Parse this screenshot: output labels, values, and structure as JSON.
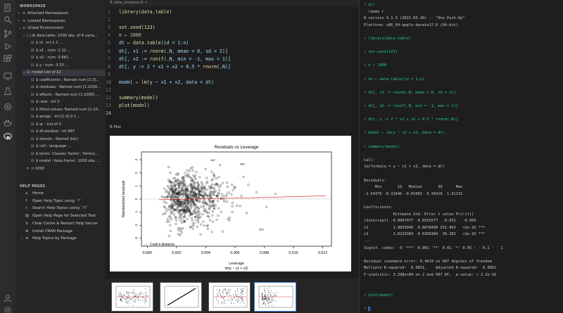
{
  "activity": {
    "icons": [
      "files-icon",
      "search-icon",
      "source-control-icon",
      "run-debug-icon",
      "extensions-icon",
      "remote-icon",
      "test-icon",
      "git-icon",
      "docker-icon",
      "r-icon",
      "account-icon",
      "settings-icon"
    ]
  },
  "workspace": {
    "title": "WORKSPACE",
    "rows": [
      {
        "text": "Attached Namespaces",
        "chev": "›",
        "icon": "≡",
        "indent": 0
      },
      {
        "text": "Loaded Namespaces",
        "chev": "›",
        "icon": "≡",
        "indent": 0
      },
      {
        "text": "Global Environment",
        "chev": "⌄",
        "icon": "≡",
        "indent": 0
      },
      {
        "text": "dt  data.table: 1000 obs. of 4 varia...",
        "chev": "⌄",
        "icon": "[ ]",
        "indent": 1
      },
      {
        "text": "$ id : int 1 2 ...",
        "chev": "",
        "icon": "⊟",
        "indent": 2
      },
      {
        "text": "$ x1 : num -1.12 ...",
        "chev": "",
        "icon": "⊟",
        "indent": 2
      },
      {
        "text": "$ x2 : num -0.681 ...",
        "chev": "",
        "icon": "⊟",
        "indent": 2
      },
      {
        "text": "$ y : num -3.33 ...",
        "chev": "",
        "icon": "⊟",
        "indent": 2
      },
      {
        "text": "model  List of 12",
        "chev": "⌄",
        "icon": "⊟",
        "indent": 1
      },
      {
        "text": "$ coefficients : Named num [1:3]...",
        "chev": "",
        "icon": "⊟",
        "indent": 2
      },
      {
        "text": "$ residuals : Named num [1:1000...",
        "chev": "",
        "icon": "⊟",
        "indent": 2
      },
      {
        "text": "$ effects : Named num [1:1000] ...",
        "chev": "",
        "icon": "⊟",
        "indent": 2
      },
      {
        "text": "$ rank : int 3",
        "chev": "",
        "icon": "⊟",
        "indent": 2
      },
      {
        "text": "$ fitted.values: Named num [1:10...",
        "chev": "",
        "icon": "⊟",
        "indent": 2
      },
      {
        "text": "$ assign : int [1:3] 0 1 ...",
        "chev": "",
        "icon": "⊟",
        "indent": 2
      },
      {
        "text": "$ qr : List of 5",
        "chev": "",
        "icon": "⊟",
        "indent": 2
      },
      {
        "text": "$ df.residual : int 997",
        "chev": "",
        "icon": "⊟",
        "indent": 2
      },
      {
        "text": "$ xlevels : Named list()",
        "chev": "",
        "icon": "⊟",
        "indent": 2
      },
      {
        "text": "$ call : language ...",
        "chev": "",
        "icon": "⊟",
        "indent": 2
      },
      {
        "text": "$ terms :Classes 'terms', 'formul...",
        "chev": "",
        "icon": "⊟",
        "indent": 2
      },
      {
        "text": "$ model :'data.frame': 1000 obs. ...",
        "chev": "",
        "icon": "⊟",
        "indent": 2
      },
      {
        "text": "n  1000",
        "chev": "",
        "icon": "π",
        "indent": 1
      }
    ]
  },
  "help": {
    "title": "HELP PAGES",
    "items": [
      {
        "label": "Home",
        "icon": "⌂",
        "chev": ""
      },
      {
        "label": "Open Help Topic using `?`",
        "icon": "?",
        "chev": ""
      },
      {
        "label": "Search Help Topics using `??`",
        "icon": "⌕",
        "chev": ""
      },
      {
        "label": "Open Help Page for Selected Text",
        "icon": "▤",
        "chev": ""
      },
      {
        "label": "Clear Cache & Restart Help Server",
        "icon": "↻",
        "chev": ""
      },
      {
        "label": "Install CRAN Package",
        "icon": "⊕",
        "chev": ""
      },
      {
        "label": "Help Topics by Package",
        "icon": "≡",
        "chev": "›"
      }
    ]
  },
  "editor": {
    "tab": "R  data_analysis.R > ...",
    "lines": [
      {
        "n": "1",
        "code": [
          {
            "t": "library(data.table)",
            "c": "#dcdcaa"
          }
        ]
      },
      {
        "n": "2",
        "code": []
      },
      {
        "n": "3",
        "code": [
          {
            "t": "set.seed(123)",
            "c": "#dcdcaa"
          }
        ]
      },
      {
        "n": "4",
        "code": [
          {
            "t": "n ",
            "c": "#9cdcfe"
          },
          {
            "t": "←",
            "c": "#d4d4d4"
          },
          {
            "t": " 1000",
            "c": "#b5cea8"
          }
        ]
      },
      {
        "n": "5",
        "code": [
          {
            "t": "dt ",
            "c": "#9cdcfe"
          },
          {
            "t": "← ",
            "c": "#d4d4d4"
          },
          {
            "t": "data.table(",
            "c": "#dcdcaa"
          },
          {
            "t": "id = 1:n)",
            "c": "#9cdcfe"
          }
        ]
      },
      {
        "n": "6",
        "code": [
          {
            "t": "dt[, x1 := ",
            "c": "#9cdcfe"
          },
          {
            "t": "rnorm(",
            "c": "#dcdcaa"
          },
          {
            "t": ".N, mean = 0, sd = 2)]",
            "c": "#9cdcfe"
          }
        ]
      },
      {
        "n": "7",
        "code": [
          {
            "t": "dt[, x2 := ",
            "c": "#9cdcfe"
          },
          {
            "t": "runif(",
            "c": "#dcdcaa"
          },
          {
            "t": ".N, min = -1, max = 1)]",
            "c": "#9cdcfe"
          }
        ]
      },
      {
        "n": "8",
        "code": [
          {
            "t": "dt[, y := 2 * x1 + x2 + 0.5 * ",
            "c": "#9cdcfe"
          },
          {
            "t": "rnorm(",
            "c": "#dcdcaa"
          },
          {
            "t": ".N)]",
            "c": "#9cdcfe"
          }
        ]
      },
      {
        "n": "9",
        "code": []
      },
      {
        "n": "10",
        "code": [
          {
            "t": "model ",
            "c": "#9cdcfe"
          },
          {
            "t": "← ",
            "c": "#d4d4d4"
          },
          {
            "t": "lm(",
            "c": "#dcdcaa"
          },
          {
            "t": "y ~ x1 + x2, data = dt)",
            "c": "#9cdcfe"
          }
        ]
      },
      {
        "n": "11",
        "code": []
      },
      {
        "n": "12",
        "code": [
          {
            "t": "summary(model)",
            "c": "#dcdcaa"
          }
        ]
      },
      {
        "n": "13",
        "code": [
          {
            "t": "plot(model)",
            "c": "#dcdcaa"
          }
        ]
      },
      {
        "n": "14",
        "code": []
      }
    ]
  },
  "plot": {
    "tab": "R Plot",
    "title": "Residuals vs Leverage",
    "xlabel": "Leverage",
    "xlabel2": "lm(y ~ x1 + x2)",
    "ylabel": "Standardized residuals",
    "legend": "Cook's distance",
    "xticks": [
      "0.000",
      "0.002",
      "0.004",
      "0.006",
      "0.008",
      "0.010",
      "0.012"
    ],
    "yticks": [
      "-3",
      "-2",
      "-1",
      "0",
      "1",
      "2",
      "3"
    ],
    "labels": [
      "667",
      "286",
      "526"
    ]
  },
  "terminal": {
    "lines": [
      {
        "p": "> ",
        "c": "q()",
        "style": "cmd"
      },
      {
        "p": "",
        "c": "  rdome r",
        "style": "plain"
      },
      {
        "p": "",
        "c": "R version 4.1.3 (2022-03-10) -- \"One Push-Up\"",
        "style": "plain"
      },
      {
        "p": "",
        "c": "Platform: x86_64-apple-darwin17.0 (64-bit)",
        "style": "plain"
      },
      {
        "p": "",
        "c": "",
        "style": "plain"
      },
      {
        "p": "> ",
        "c": "library(data.table)",
        "style": "cmd"
      },
      {
        "p": "",
        "c": "",
        "style": "plain"
      },
      {
        "p": "> ",
        "c": "set.seed(123)",
        "style": "cmd"
      },
      {
        "p": "",
        "c": "",
        "style": "plain"
      },
      {
        "p": "> ",
        "c": "n ← 1000",
        "style": "cmd"
      },
      {
        "p": "",
        "c": "",
        "style": "plain"
      },
      {
        "p": "> ",
        "c": "dt ← data.table(id = 1:n)",
        "style": "cmd"
      },
      {
        "p": "",
        "c": "",
        "style": "plain"
      },
      {
        "p": "> ",
        "c": "dt[, x1 := rnorm(.N, mean = 0, sd = 2)]",
        "style": "cmd"
      },
      {
        "p": "",
        "c": "",
        "style": "plain"
      },
      {
        "p": "> ",
        "c": "dt[, x2 := runif(.N, min = -1, max = 1)]",
        "style": "cmd"
      },
      {
        "p": "",
        "c": "",
        "style": "plain"
      },
      {
        "p": "> ",
        "c": "dt[, y := 2 * x1 + x2 + 0.5 * rnorm(.N)]",
        "style": "cmd"
      },
      {
        "p": "",
        "c": "",
        "style": "plain"
      },
      {
        "p": "> ",
        "c": "model ← lm(y ~ x1 + x2, data = dt)",
        "style": "cmd"
      },
      {
        "p": "",
        "c": "",
        "style": "plain"
      },
      {
        "p": "> ",
        "c": "summary(model)",
        "style": "cmd"
      },
      {
        "p": "",
        "c": "",
        "style": "plain"
      },
      {
        "p": "",
        "c": "Call:",
        "style": "plain"
      },
      {
        "p": "",
        "c": "lm(formula = y ~ x1 + x2, data = dt)",
        "style": "plain"
      },
      {
        "p": "",
        "c": "",
        "style": "plain"
      },
      {
        "p": "",
        "c": "Residuals:",
        "style": "plain"
      },
      {
        "p": "",
        "c": "     Min       1Q   Median       3Q      Max",
        "style": "plain"
      },
      {
        "p": "",
        "c": "-1.54376 -0.31646 -0.01093  0.34316  1.61131",
        "style": "plain"
      },
      {
        "p": "",
        "c": "",
        "style": "plain"
      },
      {
        "p": "",
        "c": "Coefficients:",
        "style": "plain"
      },
      {
        "p": "",
        "c": "             Estimate Std. Error t value Pr(>|t|)",
        "style": "plain"
      },
      {
        "p": "",
        "c": "(Intercept) -0.0007977  0.0155577  -0.051    0.959",
        "style": "plain"
      },
      {
        "p": "",
        "c": "x1           1.9855040  0.0078490 252.963   <2e-16 ***",
        "style": "plain"
      },
      {
        "p": "",
        "c": "x2           1.0224384  0.0266384  38.382   <2e-16 ***",
        "style": "plain"
      },
      {
        "p": "",
        "c": "---",
        "style": "plain"
      },
      {
        "p": "",
        "c": "Signif. codes:  0 '***' 0.001 '**' 0.01 '*' 0.05 '.' 0.1 ' ' 1",
        "style": "plain"
      },
      {
        "p": "",
        "c": "",
        "style": "plain"
      },
      {
        "p": "",
        "c": "Residual standard error: 0.4919 on 997 degrees of freedom",
        "style": "plain"
      },
      {
        "p": "",
        "c": "Multiple R-squared:  0.9851,    Adjusted R-squared:  0.9851",
        "style": "plain"
      },
      {
        "p": "",
        "c": "F-statistic: 3.298e+04 on 2 and 997 DF,  p-value: < 2.2e-16",
        "style": "plain"
      },
      {
        "p": "",
        "c": "",
        "style": "plain"
      },
      {
        "p": "",
        "c": "",
        "style": "plain"
      },
      {
        "p": "> ",
        "c": "plot(model)",
        "style": "cmd"
      },
      {
        "p": "",
        "c": "",
        "style": "plain"
      },
      {
        "p": "> ",
        "c": "",
        "style": "cursor"
      }
    ]
  }
}
